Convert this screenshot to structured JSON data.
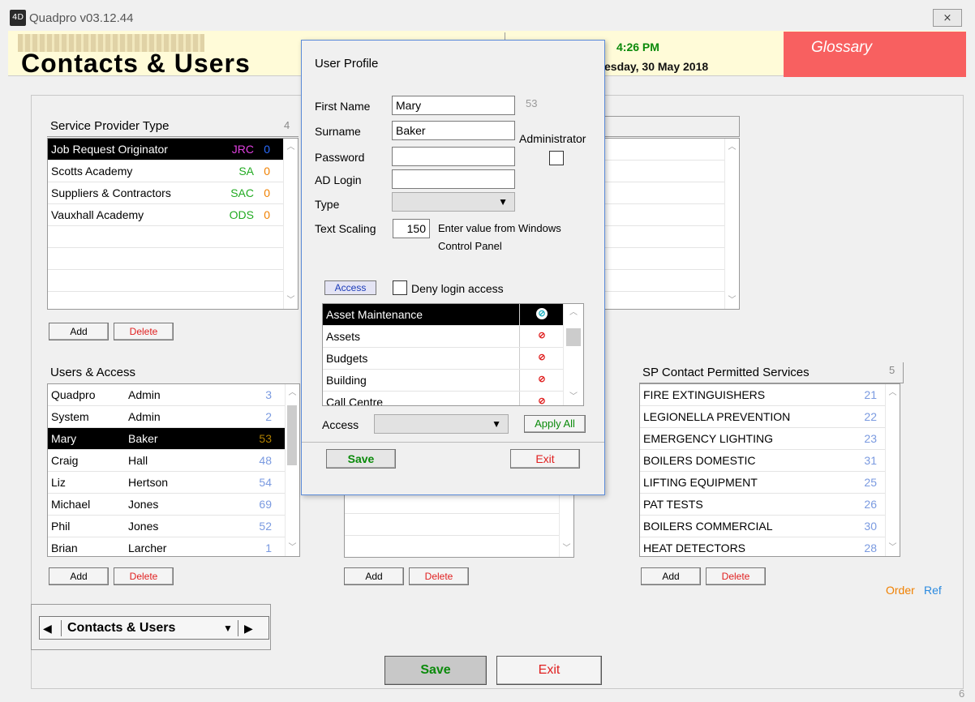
{
  "window": {
    "title": "Quadpro v03.12.44",
    "close_label": "⨯",
    "app_icon_label": "4D"
  },
  "header": {
    "logo_text": "Contacts & Users",
    "time": "4:26 PM",
    "date": "esday, 30 May 2018",
    "glossary_label": "Glossary",
    "glossary_color": "#f86060"
  },
  "service_provider_type": {
    "title": "Service Provider Type",
    "count": "4",
    "rows": [
      {
        "name": "Job Request Originator",
        "code": "JRC",
        "code_color": "#e040e0",
        "num": "0",
        "num_color": "#2a6cff",
        "selected": true
      },
      {
        "name": "Scotts Academy",
        "code": "SA",
        "code_color": "#22aa22",
        "num": "0",
        "num_color": "#f08000",
        "selected": false
      },
      {
        "name": "Suppliers & Contractors",
        "code": "SAC",
        "code_color": "#22aa22",
        "num": "0",
        "num_color": "#f08000",
        "selected": false
      },
      {
        "name": "Vauxhall Academy",
        "code": "ODS",
        "code_color": "#22aa22",
        "num": "0",
        "num_color": "#f08000",
        "selected": false
      }
    ],
    "add_label": "Add",
    "delete_label": "Delete"
  },
  "users_access": {
    "title": "Users & Access",
    "rows": [
      {
        "first": "Quadpro",
        "last": "Admin",
        "num": "3"
      },
      {
        "first": "System",
        "last": "Admin",
        "num": "2"
      },
      {
        "first": "Mary",
        "last": "Baker",
        "num": "53",
        "selected": true
      },
      {
        "first": "Craig",
        "last": "Hall",
        "num": "48"
      },
      {
        "first": "Liz",
        "last": "Hertson",
        "num": "54"
      },
      {
        "first": "Michael",
        "last": "Jones",
        "num": "69"
      },
      {
        "first": "Phil",
        "last": "Jones",
        "num": "52"
      },
      {
        "first": "Brian",
        "last": "Larcher",
        "num": "1"
      }
    ],
    "add_label": "Add",
    "delete_label": "Delete"
  },
  "middle_panel": {
    "add_label": "Add",
    "delete_label": "Delete"
  },
  "sp_contact": {
    "title": "SP Contact Permitted Services",
    "count": "5",
    "rows": [
      {
        "name": "FIRE EXTINGUISHERS",
        "num": "21"
      },
      {
        "name": "LEGIONELLA PREVENTION",
        "num": "22"
      },
      {
        "name": "EMERGENCY LIGHTING",
        "num": "23"
      },
      {
        "name": "BOILERS DOMESTIC",
        "num": "31"
      },
      {
        "name": "LIFTING EQUIPMENT",
        "num": "25"
      },
      {
        "name": "PAT TESTS",
        "num": "26"
      },
      {
        "name": "BOILERS COMMERCIAL",
        "num": "30"
      },
      {
        "name": "HEAT DETECTORS",
        "num": "28"
      }
    ],
    "add_label": "Add",
    "delete_label": "Delete"
  },
  "order_label": "Order",
  "ref_label": "Ref",
  "nav": {
    "selected": "Contacts & Users",
    "prev_icon": "◀",
    "next_icon": "▶",
    "caret": "▼"
  },
  "footer": {
    "save_label": "Save",
    "exit_label": "Exit",
    "corner_text": "6"
  },
  "dialog": {
    "title": "User Profile",
    "first_name_label": "First Name",
    "first_name_value": "Mary",
    "user_id": "53",
    "surname_label": "Surname",
    "surname_value": "Baker",
    "administrator_label": "Administrator",
    "password_label": "Password",
    "password_value": "",
    "ad_login_label": "AD Login",
    "ad_login_value": "",
    "type_label": "Type",
    "type_value": "",
    "text_scaling_label": "Text Scaling",
    "text_scaling_value": "150",
    "text_scaling_hint_1": "Enter value from Windows",
    "text_scaling_hint_2": "Control Panel",
    "access_tab_label": "Access",
    "deny_login_label": "Deny login access",
    "access_rows": [
      {
        "name": "Asset Maintenance",
        "selected": true,
        "state": "allowed"
      },
      {
        "name": "Assets",
        "state": "denied"
      },
      {
        "name": "Budgets",
        "state": "denied"
      },
      {
        "name": "Building",
        "state": "denied"
      },
      {
        "name": "Call Centre",
        "state": "denied"
      }
    ],
    "access_label": "Access",
    "access_value": "",
    "apply_all_label": "Apply All",
    "save_label": "Save",
    "exit_label": "Exit"
  }
}
